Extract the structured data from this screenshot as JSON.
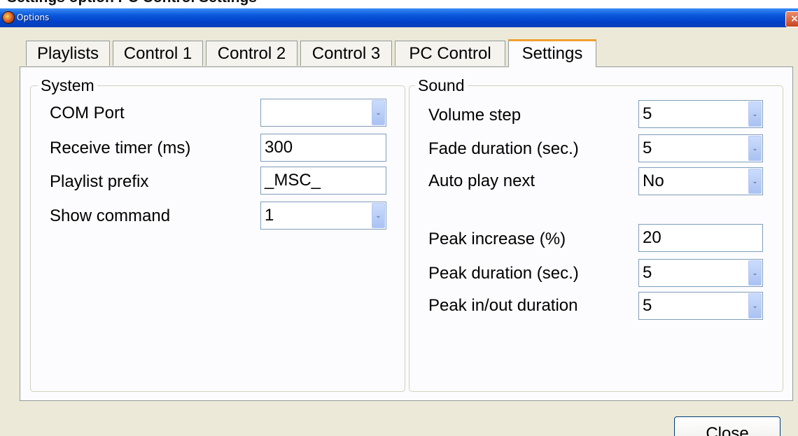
{
  "header_text": "Settings option PC Control Settings",
  "window": {
    "title": "Options",
    "close_glyph": "×"
  },
  "tabs": [
    {
      "label": "Playlists",
      "active": false
    },
    {
      "label": "Control 1",
      "active": false
    },
    {
      "label": "Control 2",
      "active": false
    },
    {
      "label": "Control 3",
      "active": false
    },
    {
      "label": "PC Control",
      "active": false
    },
    {
      "label": "Settings",
      "active": true
    }
  ],
  "system": {
    "legend": "System",
    "com_port": {
      "label": "COM Port",
      "value": ""
    },
    "receive_timer": {
      "label": "Receive timer (ms)",
      "value": "300"
    },
    "playlist_prefix": {
      "label": "Playlist prefix",
      "value": "_MSC_"
    },
    "show_command": {
      "label": "Show command",
      "value": "1"
    }
  },
  "sound": {
    "legend": "Sound",
    "volume_step": {
      "label": "Volume step",
      "value": "5"
    },
    "fade_duration": {
      "label": "Fade duration (sec.)",
      "value": "5"
    },
    "auto_play_next": {
      "label": "Auto play next",
      "value": "No"
    },
    "peak_increase": {
      "label": "Peak increase (%)",
      "value": "20"
    },
    "peak_duration": {
      "label": "Peak duration (sec.)",
      "value": "5"
    },
    "peak_inout_duration": {
      "label": "Peak in/out duration",
      "value": "5"
    }
  },
  "buttons": {
    "close": "Close"
  },
  "icons": {
    "combo_arrow": "⌄",
    "app_icon": "app-icon"
  },
  "colors": {
    "titlebar": "#0b59dc",
    "dialog_bg": "#ece9d8",
    "panel_bg": "#fcfcfe",
    "active_tab_accent": "#f0a030"
  }
}
